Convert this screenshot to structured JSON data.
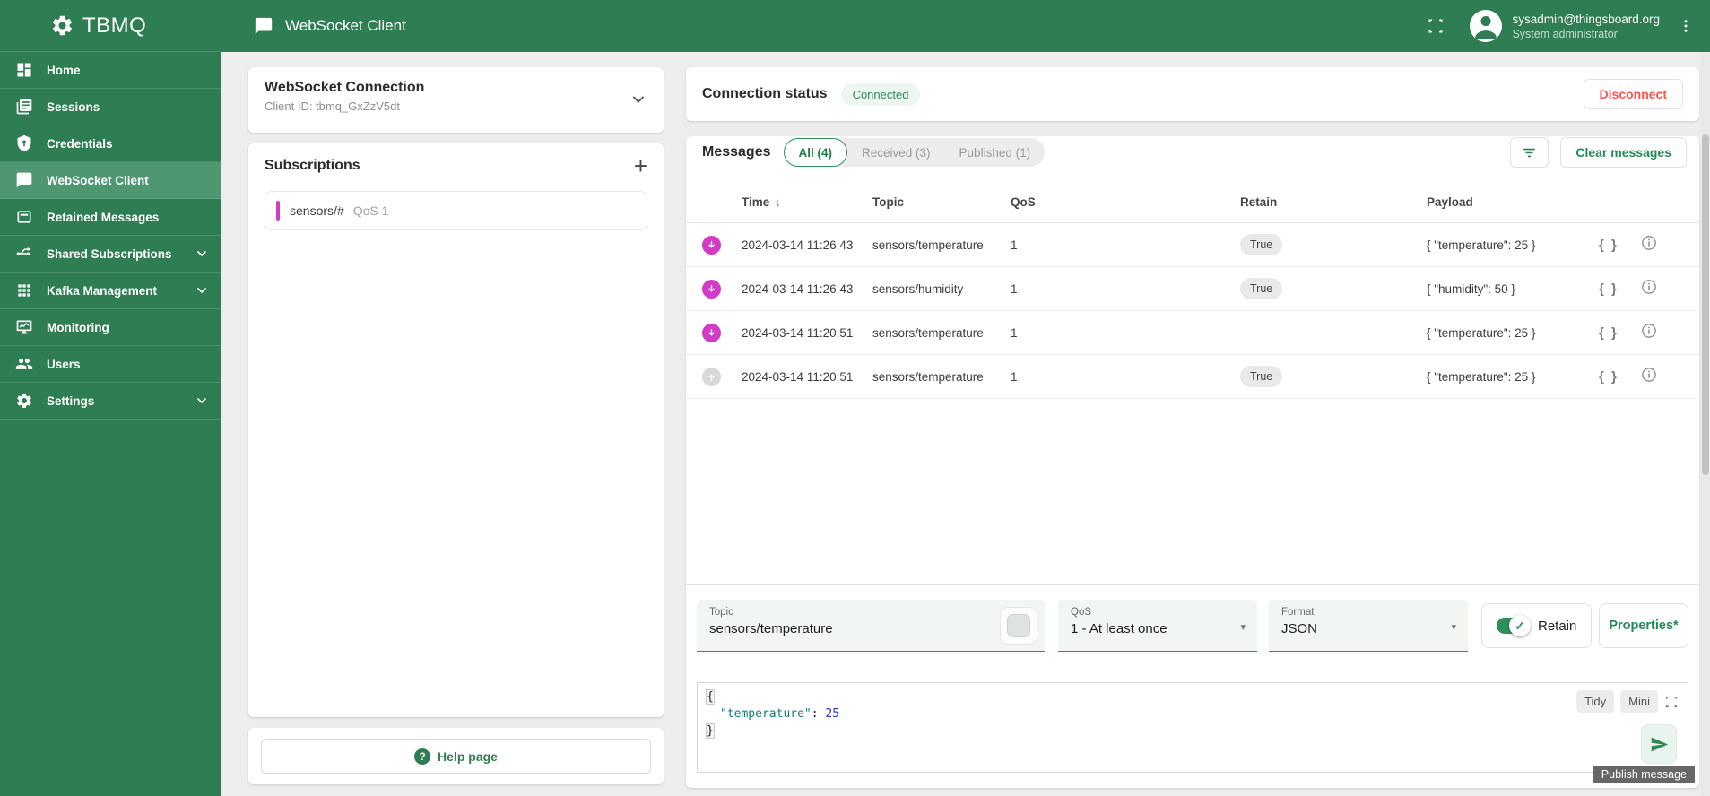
{
  "theme": {
    "brand_green": "#2F7D52",
    "active_green": "#4F9772",
    "accent_green": "#1F8A55",
    "magenta": "#D23BC6",
    "danger_red": "#F5564C",
    "json_key_color": "#0E8074",
    "json_number_color": "#2237cf"
  },
  "sidebar": {
    "logo": "TBMQ",
    "items": [
      {
        "label": "Home",
        "icon": "dashboard-icon"
      },
      {
        "label": "Sessions",
        "icon": "sessions-icon"
      },
      {
        "label": "Credentials",
        "icon": "credentials-icon"
      },
      {
        "label": "WebSocket Client",
        "icon": "chat-icon",
        "active": true
      },
      {
        "label": "Retained Messages",
        "icon": "archive-icon"
      },
      {
        "label": "Shared Subscriptions",
        "icon": "share-split-icon",
        "expandable": true
      },
      {
        "label": "Kafka Management",
        "icon": "apps-grid-icon",
        "expandable": true
      },
      {
        "label": "Monitoring",
        "icon": "monitor-icon"
      },
      {
        "label": "Users",
        "icon": "people-icon"
      },
      {
        "label": "Settings",
        "icon": "gear-icon",
        "expandable": true
      }
    ]
  },
  "topbar": {
    "title": "WebSocket Client",
    "user_email": "sysadmin@thingsboard.org",
    "user_role": "System administrator"
  },
  "connection_card": {
    "title": "WebSocket Connection",
    "client_id": "Client ID: tbmq_GxZzV5dt"
  },
  "subscriptions": {
    "title": "Subscriptions",
    "items": [
      {
        "topic": "sensors/#",
        "qos": "QoS 1"
      }
    ]
  },
  "help": {
    "label": "Help page"
  },
  "status": {
    "label": "Connection status",
    "badge": "Connected",
    "disconnect": "Disconnect"
  },
  "messages": {
    "title": "Messages",
    "tabs": [
      {
        "label": "All (4)",
        "selected": true
      },
      {
        "label": "Received (3)",
        "selected": false
      },
      {
        "label": "Published (1)",
        "selected": false
      }
    ],
    "clear": "Clear messages"
  },
  "table": {
    "headers": {
      "time": "Time",
      "sort": "↓",
      "topic": "Topic",
      "qos": "QoS",
      "retain": "Retain",
      "payload": "Payload"
    },
    "rows": [
      {
        "direction": "received",
        "time": "2024-03-14 11:26:43",
        "topic": "sensors/temperature",
        "qos": "1",
        "retain": "True",
        "payload": "{ \"temperature\": 25 }"
      },
      {
        "direction": "received",
        "time": "2024-03-14 11:26:43",
        "topic": "sensors/humidity",
        "qos": "1",
        "retain": "True",
        "payload": "{ \"humidity\": 50 }"
      },
      {
        "direction": "received",
        "time": "2024-03-14 11:20:51",
        "topic": "sensors/temperature",
        "qos": "1",
        "retain": "",
        "payload": "{ \"temperature\": 25 }"
      },
      {
        "direction": "published",
        "time": "2024-03-14 11:20:51",
        "topic": "sensors/temperature",
        "qos": "1",
        "retain": "True",
        "payload": "{ \"temperature\": 25 }"
      }
    ],
    "row_icons": {
      "json_braces": "{ }"
    }
  },
  "publish": {
    "topic_label": "Topic",
    "topic_value": "sensors/temperature",
    "qos_label": "QoS",
    "qos_value": "1 - At least once",
    "format_label": "Format",
    "format_value": "JSON",
    "retain_label": "Retain",
    "retain_on": "✓",
    "properties_label": "Properties*",
    "tidy": "Tidy",
    "mini": "Mini",
    "tooltip": "Publish message",
    "editor": {
      "open_brace": "{",
      "key": "\"temperature\"",
      "colon": ": ",
      "value": "25",
      "close_brace": "}"
    }
  }
}
